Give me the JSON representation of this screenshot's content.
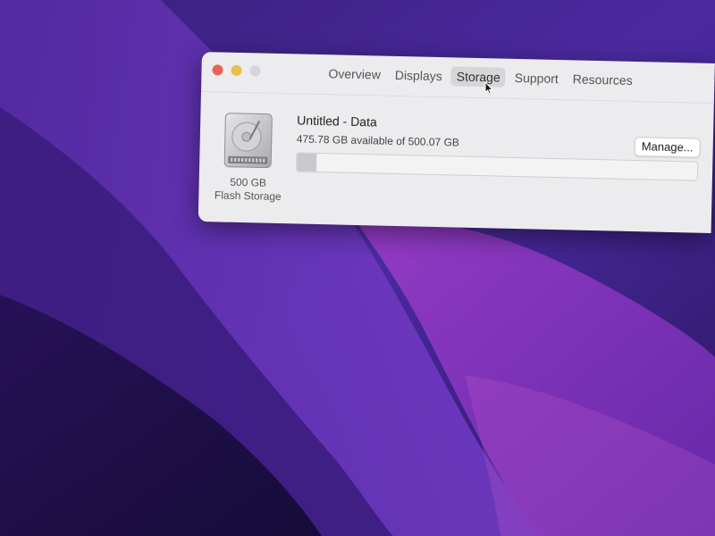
{
  "window": {
    "tabs": [
      {
        "label": "Overview",
        "active": false
      },
      {
        "label": "Displays",
        "active": false
      },
      {
        "label": "Storage",
        "active": true
      },
      {
        "label": "Support",
        "active": false
      },
      {
        "label": "Resources",
        "active": false
      }
    ]
  },
  "storage": {
    "drive_size": "500 GB",
    "drive_type": "Flash Storage",
    "volume_name": "Untitled - Data",
    "available_text": "475.78 GB available of 500.07 GB",
    "used_fraction": 0.049,
    "manage_label": "Manage..."
  },
  "colors": {
    "close": "#ec5f58",
    "minimize": "#e8c04a",
    "zoom": "#d6d5d8"
  }
}
